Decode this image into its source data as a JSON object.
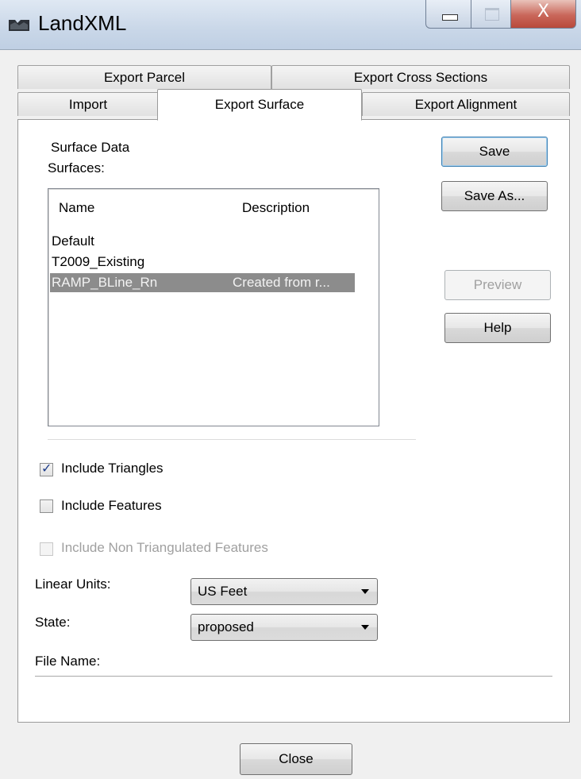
{
  "window": {
    "title": "LandXML",
    "close_glyph": "X"
  },
  "tabs": {
    "row1": [
      "Export Parcel",
      "Export Cross Sections"
    ],
    "row2": [
      "Import",
      "Export Surface",
      "Export Alignment"
    ],
    "active": "Export Surface"
  },
  "surface": {
    "group_title": "Surface Data",
    "surfaces_label": "Surfaces:",
    "columns": [
      "Name",
      "Description"
    ],
    "rows": [
      {
        "name": "Default",
        "description": ""
      },
      {
        "name": "T2009_Existing",
        "description": ""
      },
      {
        "name": "RAMP_BLine_Rn",
        "description": "Created from r...",
        "selected": true
      }
    ]
  },
  "buttons": {
    "save": "Save",
    "save_as": "Save As...",
    "preview": "Preview",
    "help": "Help",
    "close": "Close"
  },
  "options": {
    "include_triangles": {
      "label": "Include Triangles",
      "checked": true
    },
    "include_features": {
      "label": "Include Features",
      "checked": false
    },
    "include_non_triangulated": {
      "label": "Include Non Triangulated Features",
      "checked": false,
      "enabled": false
    }
  },
  "fields": {
    "linear_units_label": "Linear Units:",
    "linear_units_value": "US Feet",
    "state_label": "State:",
    "state_value": "proposed",
    "file_name_label": "File Name:",
    "file_name_value": ""
  }
}
